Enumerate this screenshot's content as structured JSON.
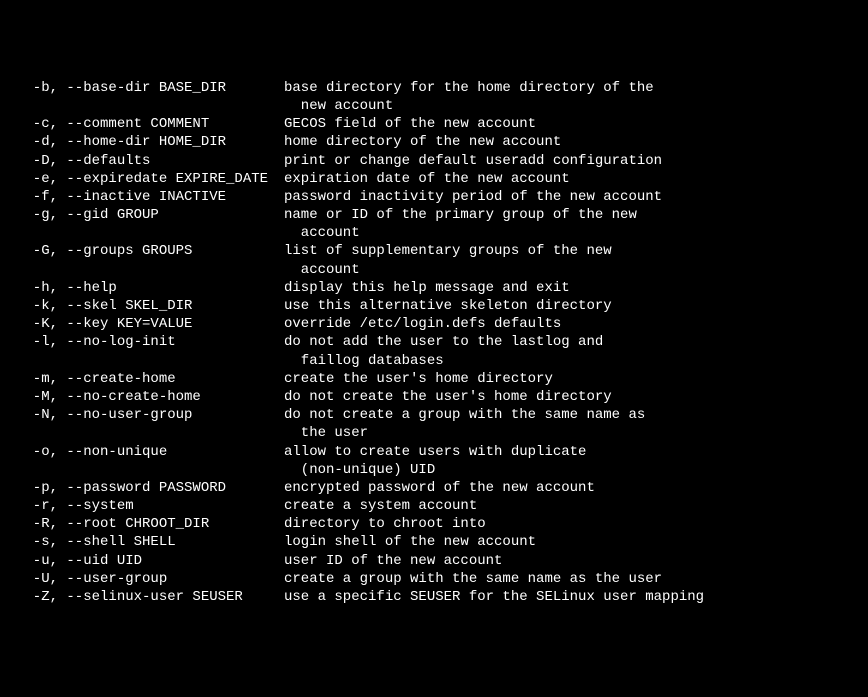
{
  "options": [
    {
      "opt": "-b, --base-dir BASE_DIR",
      "desc": [
        "base directory for the home directory of the",
        "new account"
      ]
    },
    {
      "opt": "-c, --comment COMMENT",
      "desc": [
        "GECOS field of the new account"
      ]
    },
    {
      "opt": "-d, --home-dir HOME_DIR",
      "desc": [
        "home directory of the new account"
      ]
    },
    {
      "opt": "-D, --defaults",
      "desc": [
        "print or change default useradd configuration"
      ]
    },
    {
      "opt": "-e, --expiredate EXPIRE_DATE",
      "desc": [
        "expiration date of the new account"
      ]
    },
    {
      "opt": "-f, --inactive INACTIVE",
      "desc": [
        "password inactivity period of the new account"
      ]
    },
    {
      "opt": "-g, --gid GROUP",
      "desc": [
        "name or ID of the primary group of the new",
        "account"
      ]
    },
    {
      "opt": "-G, --groups GROUPS",
      "desc": [
        "list of supplementary groups of the new",
        "account"
      ]
    },
    {
      "opt": "-h, --help",
      "desc": [
        "display this help message and exit"
      ]
    },
    {
      "opt": "-k, --skel SKEL_DIR",
      "desc": [
        "use this alternative skeleton directory"
      ]
    },
    {
      "opt": "-K, --key KEY=VALUE",
      "desc": [
        "override /etc/login.defs defaults"
      ]
    },
    {
      "opt": "-l, --no-log-init",
      "desc": [
        "do not add the user to the lastlog and",
        "faillog databases"
      ]
    },
    {
      "opt": "-m, --create-home",
      "desc": [
        "create the user's home directory"
      ]
    },
    {
      "opt": "-M, --no-create-home",
      "desc": [
        "do not create the user's home directory"
      ]
    },
    {
      "opt": "-N, --no-user-group",
      "desc": [
        "do not create a group with the same name as",
        "the user"
      ]
    },
    {
      "opt": "-o, --non-unique",
      "desc": [
        "allow to create users with duplicate",
        "(non-unique) UID"
      ]
    },
    {
      "opt": "-p, --password PASSWORD",
      "desc": [
        "encrypted password of the new account"
      ]
    },
    {
      "opt": "-r, --system",
      "desc": [
        "create a system account"
      ]
    },
    {
      "opt": "-R, --root CHROOT_DIR",
      "desc": [
        "directory to chroot into"
      ]
    },
    {
      "opt": "-s, --shell SHELL",
      "desc": [
        "login shell of the new account"
      ]
    },
    {
      "opt": "-u, --uid UID",
      "desc": [
        "user ID of the new account"
      ]
    },
    {
      "opt": "-U, --user-group",
      "desc": [
        "create a group with the same name as the user"
      ]
    },
    {
      "opt": "-Z, --selinux-user SEUSER",
      "desc": [
        "use a specific SEUSER for the SELinux user mapping"
      ]
    }
  ]
}
